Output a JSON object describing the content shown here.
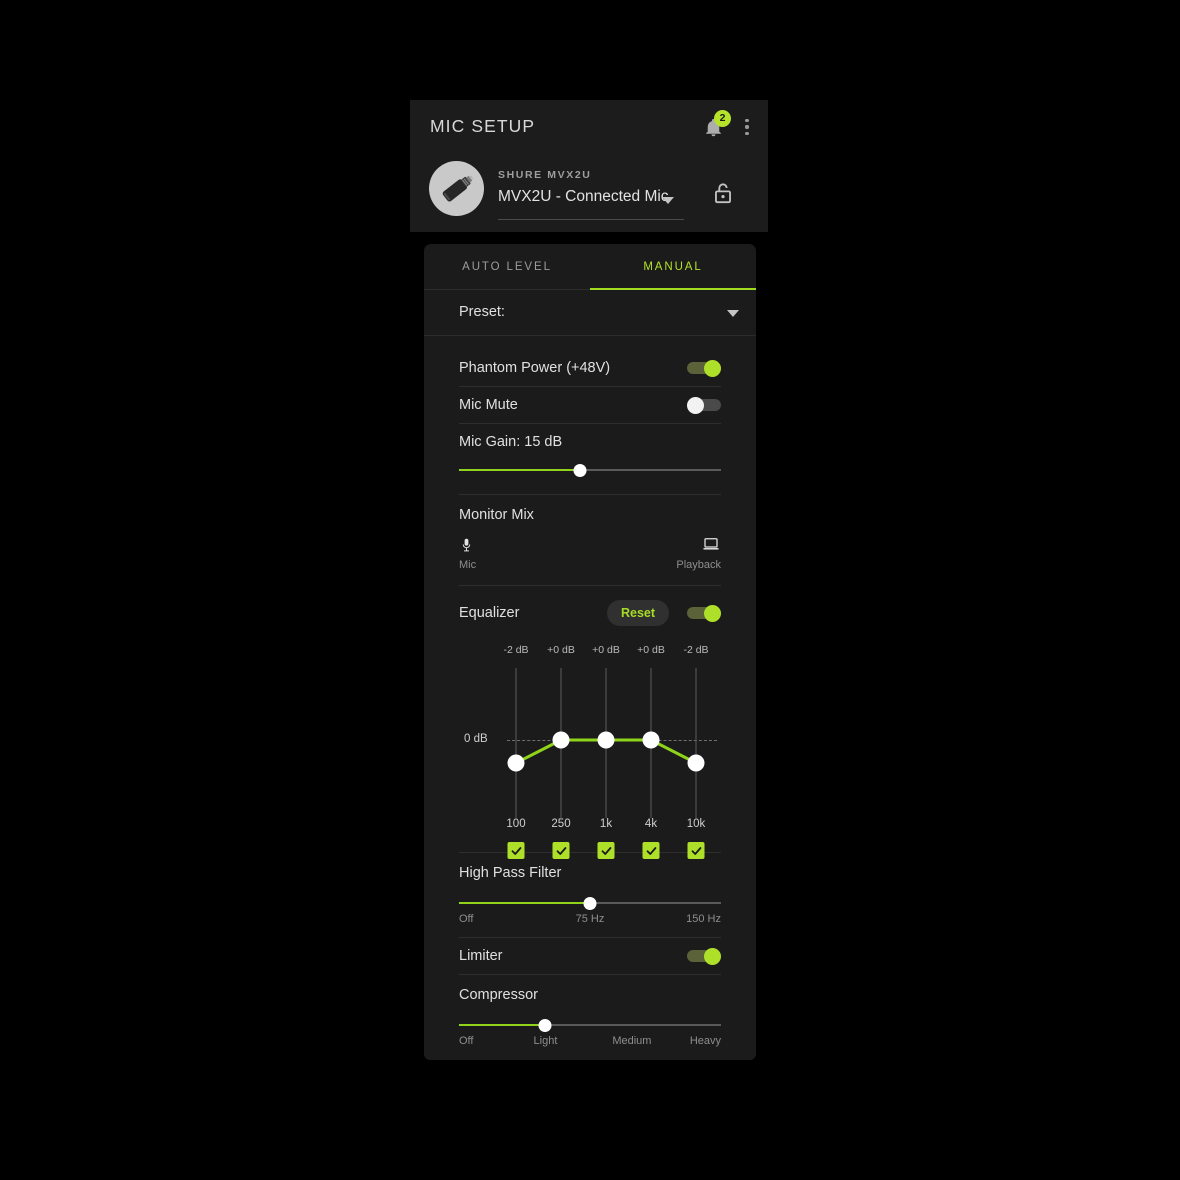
{
  "header": {
    "title": "MIC SETUP",
    "bell_icon": "bell-icon",
    "notification_count": "2",
    "menu_icon": "kebab-menu-icon",
    "device_brand": "SHURE MVX2U",
    "device_name": "MVX2U - Connected Mic",
    "lock_icon": "unlocked-padlock-icon",
    "avatar_icon": "mic-adapter-avatar"
  },
  "tabs": [
    {
      "label": "AUTO LEVEL",
      "active": false
    },
    {
      "label": "MANUAL",
      "active": true
    }
  ],
  "preset": {
    "label": "Preset:",
    "value": "",
    "caret_icon": "chevron-down-icon"
  },
  "settings": {
    "phantom_power": {
      "label": "Phantom Power (+48V)",
      "state": "on"
    },
    "mic_mute": {
      "label": "Mic Mute",
      "state": "off"
    },
    "mic_gain": {
      "label": "Mic Gain: 15 dB",
      "value": 15,
      "min": 0,
      "max": 60,
      "percent": 46
    },
    "monitor_mix": {
      "label": "Monitor Mix",
      "left_icon": "microphone-icon",
      "right_icon": "laptop-icon",
      "left_label": "Mic",
      "right_label": "Playback",
      "percent": 50
    },
    "equalizer": {
      "label": "Equalizer",
      "reset_label": "Reset",
      "state": "on",
      "zero_label": "0 dB"
    },
    "high_pass_filter": {
      "label": "High Pass Filter",
      "percent": 50,
      "scale": [
        "Off",
        "75 Hz",
        "150 Hz"
      ]
    },
    "limiter": {
      "label": "Limiter",
      "state": "on"
    },
    "compressor": {
      "label": "Compressor",
      "percent": 33,
      "scale": [
        "Off",
        "Light",
        "Medium",
        "Heavy"
      ]
    }
  },
  "chart_data": {
    "type": "line",
    "title": "Equalizer",
    "xlabel": "",
    "ylabel": "dB",
    "categories": [
      "100",
      "250",
      "1k",
      "4k",
      "10k"
    ],
    "values": [
      -2,
      0,
      0,
      0,
      -2
    ],
    "value_labels": [
      "-2 dB",
      "+0 dB",
      "+0 dB",
      "+0 dB",
      "-2 dB"
    ],
    "band_enabled": [
      true,
      true,
      true,
      true,
      true
    ],
    "ylim": [
      -6,
      6
    ],
    "zero_line": 0,
    "grid": false,
    "legend": "none",
    "line_color": "#8fd41a",
    "point_color": "#ffffff"
  },
  "colors": {
    "accent_green": "#aee02a",
    "line_green": "#8fd41a",
    "page_bg": "#000000",
    "card_bg": "#1b1b1b",
    "header_bg": "#1c1c1c"
  }
}
